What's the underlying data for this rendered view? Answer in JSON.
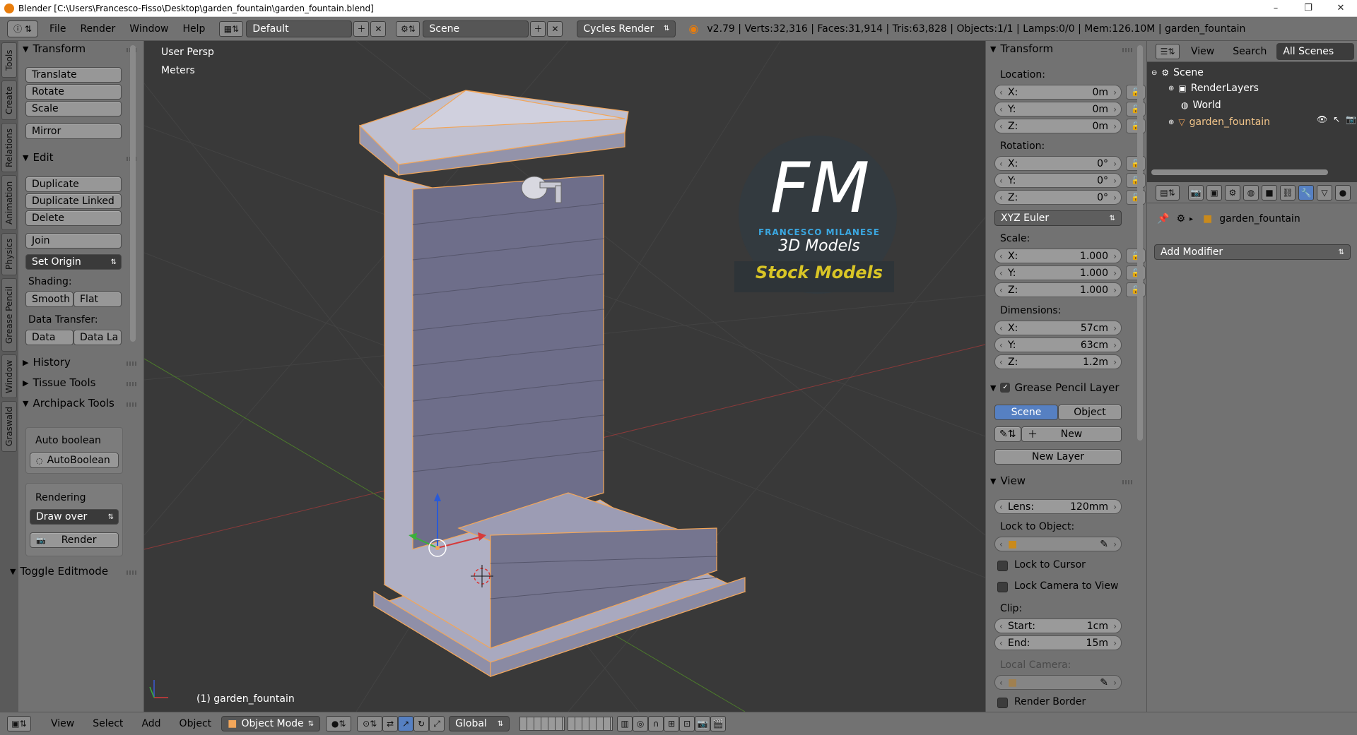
{
  "window": {
    "title": "Blender [C:\\Users\\Francesco-Fisso\\Desktop\\garden_fountain\\garden_fountain.blend]",
    "minimize": "–",
    "maximize": "❐",
    "close": "✕"
  },
  "topbar": {
    "menu": [
      "File",
      "Render",
      "Window",
      "Help"
    ],
    "screen_layout": "Default",
    "scene": "Scene",
    "render_engine": "Cycles Render",
    "stats": "v2.79 | Verts:32,316 | Faces:31,914 | Tris:63,828 | Objects:1/1 | Lamps:0/0 | Mem:126.10M | garden_fountain"
  },
  "tool_tabs": [
    "Tools",
    "Create",
    "Relations",
    "Animation",
    "Physics",
    "Grease Pencil",
    "Window",
    "Graswald"
  ],
  "tool_shelf": {
    "transform_header": "Transform",
    "translate": "Translate",
    "rotate": "Rotate",
    "scale": "Scale",
    "mirror": "Mirror",
    "edit_header": "Edit",
    "duplicate": "Duplicate",
    "duplicate_linked": "Duplicate Linked",
    "delete": "Delete",
    "join": "Join",
    "set_origin": "Set Origin",
    "shading_label": "Shading:",
    "smooth": "Smooth",
    "flat": "Flat",
    "data_transfer_label": "Data Transfer:",
    "data": "Data",
    "data_la": "Data La",
    "history": "History",
    "tissue_tools": "Tissue Tools",
    "archipack_tools": "Archipack Tools",
    "auto_boolean_label": "Auto boolean",
    "auto_boolean_btn": "AutoBoolean",
    "rendering_label": "Rendering",
    "draw_over": "Draw over",
    "render": "Render",
    "toggle_editmode": "Toggle Editmode"
  },
  "viewport": {
    "view_name": "User Persp",
    "units": "Meters",
    "object_label": "(1) garden_fountain",
    "logo_letters": "FM",
    "logo_name": "FRANCESCO MILANESE",
    "logo_sub": "3D Models",
    "stock_models": "Stock Models"
  },
  "properties_n": {
    "transform_header": "Transform",
    "location_label": "Location:",
    "location": {
      "x": "0m",
      "y": "0m",
      "z": "0m"
    },
    "rotation_label": "Rotation:",
    "rotation": {
      "x": "0°",
      "y": "0°",
      "z": "0°"
    },
    "rotation_mode": "XYZ Euler",
    "scale_label": "Scale:",
    "scale": {
      "x": "1.000",
      "y": "1.000",
      "z": "1.000"
    },
    "dimensions_label": "Dimensions:",
    "dimensions": {
      "x": "57cm",
      "y": "63cm",
      "z": "1.2m"
    },
    "axis_x": "X:",
    "axis_y": "Y:",
    "axis_z": "Z:",
    "grease_pencil_header": "Grease Pencil Layer",
    "gp_scene": "Scene",
    "gp_object": "Object",
    "gp_new": "New",
    "gp_new_layer": "New Layer",
    "view_header": "View",
    "lens_label": "Lens:",
    "lens_value": "120mm",
    "lock_to_object": "Lock to Object:",
    "lock_to_cursor": "Lock to Cursor",
    "lock_camera_to_view": "Lock Camera to View",
    "clip_label": "Clip:",
    "clip_start_label": "Start:",
    "clip_start": "1cm",
    "clip_end_label": "End:",
    "clip_end": "15m",
    "local_camera": "Local Camera:",
    "render_border": "Render Border"
  },
  "outliner": {
    "view": "View",
    "search": "Search",
    "all_scenes": "All Scenes",
    "scene": "Scene",
    "render_layers": "RenderLayers",
    "world": "World",
    "object": "garden_fountain"
  },
  "modifier_panel": {
    "object": "garden_fountain",
    "add_modifier": "Add Modifier"
  },
  "bottombar": {
    "view": "View",
    "select": "Select",
    "add": "Add",
    "object": "Object",
    "mode": "Object Mode",
    "orientation": "Global"
  },
  "colors": {
    "ui_gray": "#727272",
    "viewport_bg": "#393939",
    "selection_orange": "#f2a65a",
    "accent_blue": "#5680c2",
    "logo_blue": "#3ba7e0",
    "stock_yellow": "#d9c526"
  }
}
